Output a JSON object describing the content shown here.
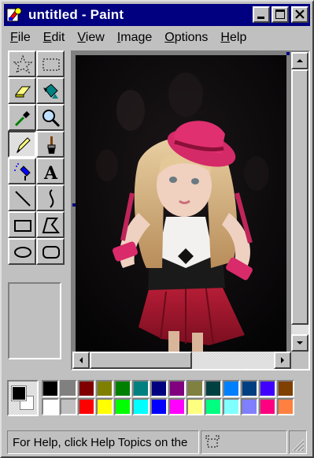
{
  "window": {
    "title": "untitled - Paint",
    "colors": {
      "titlebar": "#000080",
      "face": "#c0c0c0"
    }
  },
  "caption_buttons": [
    "minimize-button",
    "maximize-button",
    "close-button"
  ],
  "menu": {
    "items": [
      {
        "key": "F",
        "rest": "ile"
      },
      {
        "key": "E",
        "rest": "dit"
      },
      {
        "key": "V",
        "rest": "iew"
      },
      {
        "key": "I",
        "rest": "mage"
      },
      {
        "key": "O",
        "rest": "ptions"
      },
      {
        "key": "H",
        "rest": "elp"
      }
    ]
  },
  "tools": [
    {
      "name": "free-form-select",
      "icon": "star-select-icon"
    },
    {
      "name": "select",
      "icon": "rect-select-icon"
    },
    {
      "name": "eraser",
      "icon": "eraser-icon"
    },
    {
      "name": "fill-with-color",
      "icon": "paint-bucket-icon"
    },
    {
      "name": "pick-color",
      "icon": "eyedropper-icon"
    },
    {
      "name": "magnifier",
      "icon": "magnifier-icon"
    },
    {
      "name": "pencil",
      "icon": "pencil-icon",
      "selected": true
    },
    {
      "name": "brush",
      "icon": "brush-icon"
    },
    {
      "name": "airbrush",
      "icon": "airbrush-icon"
    },
    {
      "name": "text",
      "icon": "text-icon",
      "label": "A"
    },
    {
      "name": "line",
      "icon": "line-icon"
    },
    {
      "name": "curve",
      "icon": "curve-icon"
    },
    {
      "name": "rectangle",
      "icon": "rectangle-icon"
    },
    {
      "name": "polygon",
      "icon": "polygon-icon"
    },
    {
      "name": "ellipse",
      "icon": "ellipse-icon"
    },
    {
      "name": "rounded-rectangle",
      "icon": "rounded-rectangle-icon"
    }
  ],
  "palette": {
    "foreground": "#000000",
    "background": "#ffffff",
    "top_row": [
      "#000000",
      "#808080",
      "#800000",
      "#808000",
      "#008000",
      "#008080",
      "#000080",
      "#800080",
      "#808040",
      "#004040",
      "#0080ff",
      "#004080",
      "#4000ff",
      "#804000"
    ],
    "bottom_row": [
      "#ffffff",
      "#c0c0c0",
      "#ff0000",
      "#ffff00",
      "#00ff00",
      "#00ffff",
      "#0000ff",
      "#ff00ff",
      "#ffff80",
      "#00ff80",
      "#80ffff",
      "#8080ff",
      "#ff0080",
      "#ff8040"
    ]
  },
  "status": {
    "help_text": "For Help, click Help Topics on the"
  }
}
